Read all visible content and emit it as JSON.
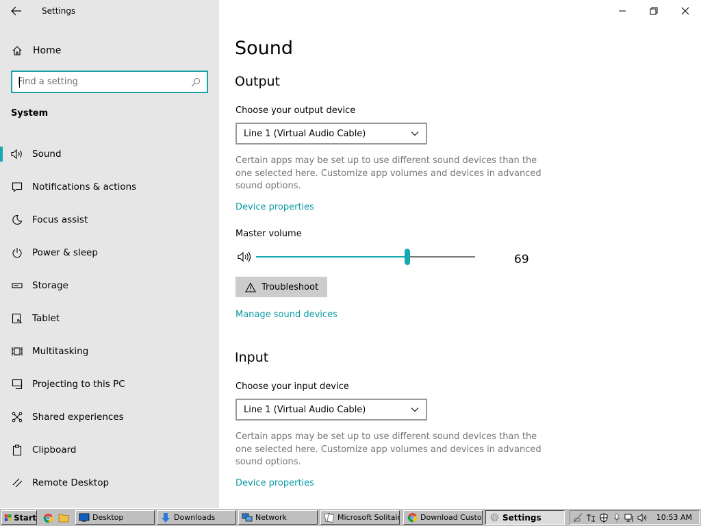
{
  "window": {
    "title": "Settings",
    "controls": {
      "minimize": "minimize-icon",
      "restore": "restore-icon",
      "close": "close-icon"
    }
  },
  "sidebar": {
    "home_label": "Home",
    "search_placeholder": "Find a setting",
    "section_title": "System",
    "selected": "Sound",
    "items": [
      {
        "label": "Sound",
        "icon": "speaker-icon"
      },
      {
        "label": "Notifications & actions",
        "icon": "message-icon"
      },
      {
        "label": "Focus assist",
        "icon": "moon-icon"
      },
      {
        "label": "Power & sleep",
        "icon": "power-icon"
      },
      {
        "label": "Storage",
        "icon": "storage-icon"
      },
      {
        "label": "Tablet",
        "icon": "tablet-icon"
      },
      {
        "label": "Multitasking",
        "icon": "multitasking-icon"
      },
      {
        "label": "Projecting to this PC",
        "icon": "projecting-icon"
      },
      {
        "label": "Shared experiences",
        "icon": "shared-icon"
      },
      {
        "label": "Clipboard",
        "icon": "clipboard-icon"
      },
      {
        "label": "Remote Desktop",
        "icon": "remote-icon"
      }
    ]
  },
  "main": {
    "page_title": "Sound",
    "output": {
      "heading": "Output",
      "device_label": "Choose your output device",
      "device_value": "Line 1 (Virtual Audio Cable)",
      "description": "Certain apps may be set up to use different sound devices than the one selected here. Customize app volumes and devices in advanced sound options.",
      "device_properties_link": "Device properties",
      "volume_label": "Master volume",
      "volume_value": "69",
      "volume_level": 69,
      "troubleshoot_label": "Troubleshoot",
      "manage_link": "Manage sound devices"
    },
    "input": {
      "heading": "Input",
      "device_label": "Choose your input device",
      "device_value": "Line 1 (Virtual Audio Cable)",
      "description": "Certain apps may be set up to use different sound devices than the one selected here. Customize app volumes and devices in advanced sound options.",
      "device_properties_link": "Device properties"
    }
  },
  "taskbar": {
    "start_label": "Start",
    "tasks": [
      {
        "label": "Desktop",
        "icon": "desktop-icon"
      },
      {
        "label": "Downloads",
        "icon": "download-arrow-icon"
      },
      {
        "label": "Network",
        "icon": "network-icon"
      },
      {
        "label": "Microsoft Solitaire...",
        "icon": "cards-icon"
      },
      {
        "label": "Download Custo...",
        "icon": "chrome-icon"
      },
      {
        "label": "Settings",
        "icon": "gear-icon",
        "active": true
      }
    ],
    "clock": "10:53 AM"
  },
  "colors": {
    "accent": "#17a9b2",
    "sidebar_bg": "#e6e6e6",
    "link": "#0a9aa4",
    "taskbar_bg": "#c0c0c0"
  }
}
